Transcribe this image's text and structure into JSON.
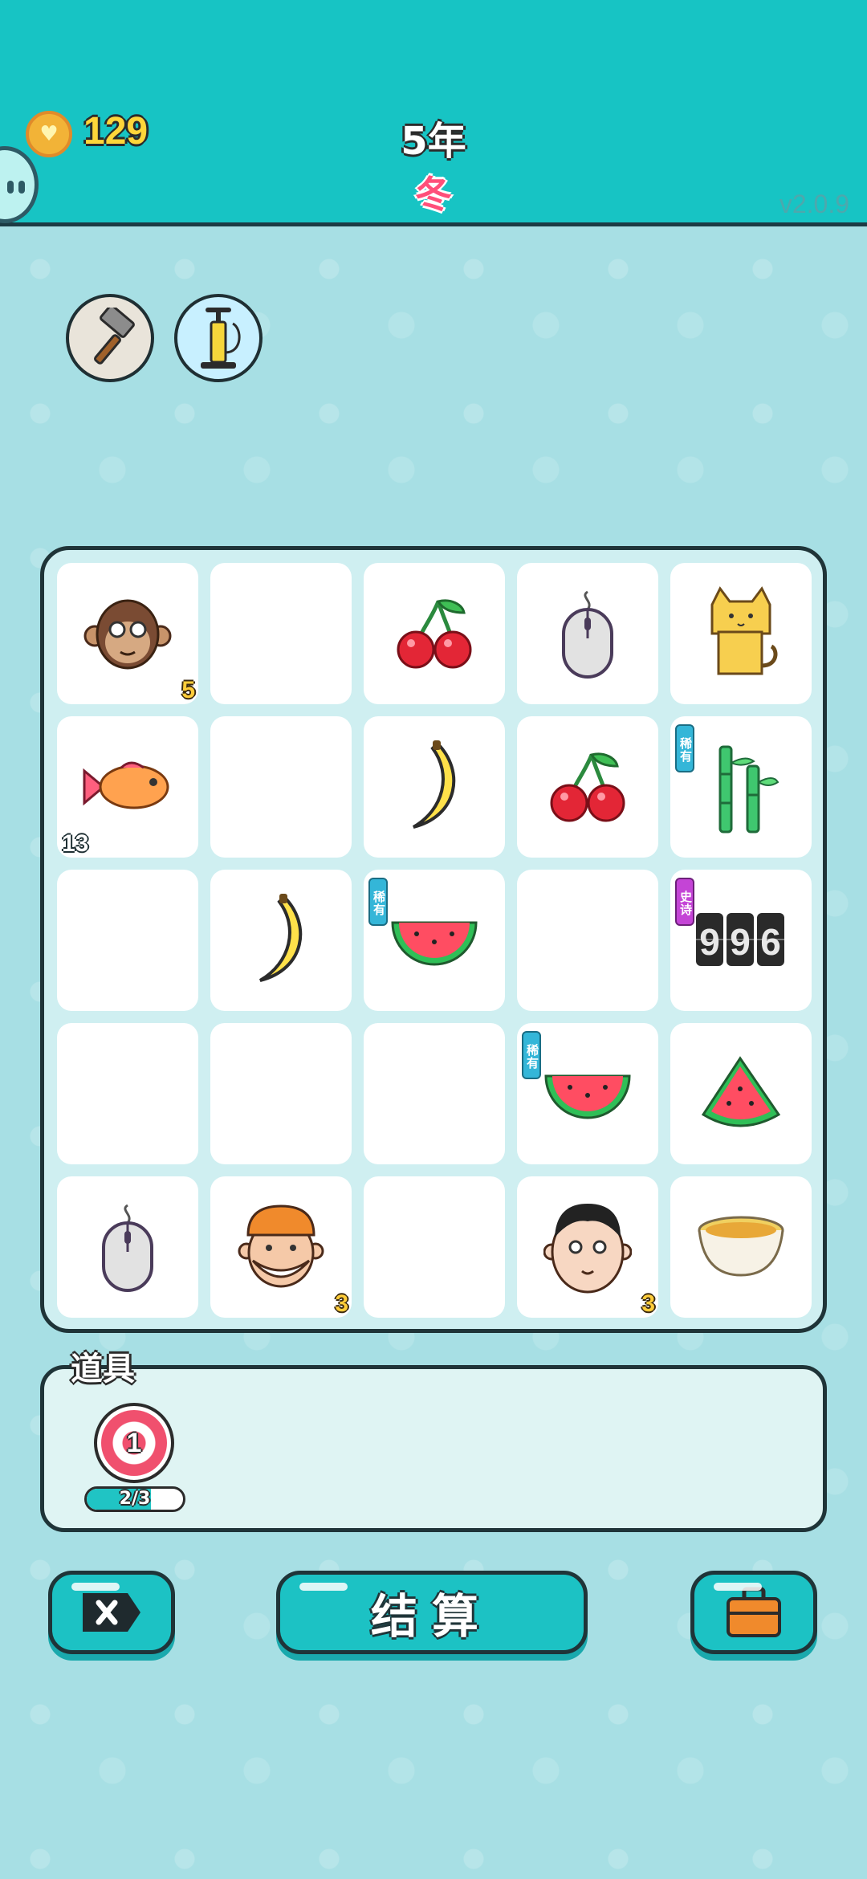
{
  "header": {
    "coins": "129",
    "year": "5年",
    "season": "冬",
    "version": "v2.0.9"
  },
  "tools": [
    {
      "name": "hammer-icon"
    },
    {
      "name": "air-pump-icon"
    }
  ],
  "board": {
    "rows": 5,
    "cols": 5,
    "cells": [
      {
        "item": "monkey",
        "number": "5"
      },
      {
        "item": null
      },
      {
        "item": "cherry"
      },
      {
        "item": "mouse"
      },
      {
        "item": "cat"
      },
      {
        "item": "fish",
        "number_left": "13"
      },
      {
        "item": null
      },
      {
        "item": "banana"
      },
      {
        "item": "cherry"
      },
      {
        "item": "bamboo",
        "tag": "稀有"
      },
      {
        "item": null
      },
      {
        "item": "banana"
      },
      {
        "item": "watermelon",
        "tag": "稀有"
      },
      {
        "item": null
      },
      {
        "item": "digits-996",
        "tag": "史诗",
        "digits": "996"
      },
      {
        "item": null
      },
      {
        "item": null
      },
      {
        "item": null
      },
      {
        "item": "watermelon",
        "tag": "稀有"
      },
      {
        "item": "watermelon-slice"
      },
      {
        "item": "mouse"
      },
      {
        "item": "delivery-man",
        "number": "3"
      },
      {
        "item": null
      },
      {
        "item": "man-face",
        "number": "3"
      },
      {
        "item": "soup-bowl"
      }
    ]
  },
  "items_panel": {
    "title": "道具",
    "target": {
      "count": "1",
      "progress_label": "2/3",
      "progress": 0.667
    }
  },
  "buttons": {
    "settle_label": "结算"
  },
  "colors": {
    "accent": "#17c4c4",
    "background": "#a7dfe4",
    "coin_text": "#ffd63a",
    "season_text": "#ff4f7a",
    "rare_tag": "#34b6d8",
    "epic_tag": "#c444d6"
  }
}
